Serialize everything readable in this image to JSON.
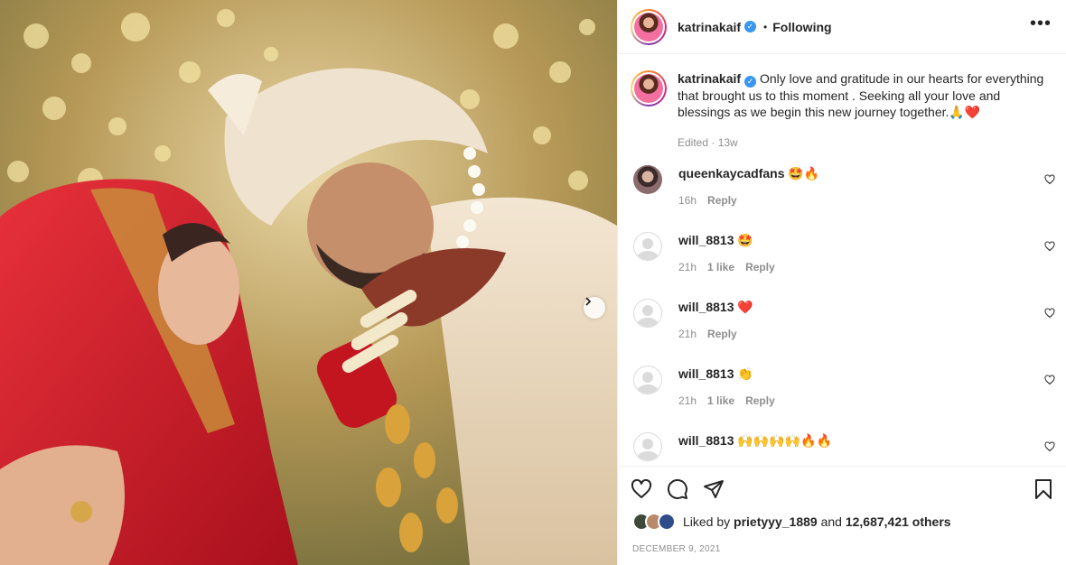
{
  "post": {
    "username": "katrinakaif",
    "follow_status": "Following",
    "separator": "•",
    "more": "•••",
    "media_alt": "Wedding photo of bride and groom embracing"
  },
  "caption": {
    "username": "katrinakaif",
    "text": "Only love and gratitude in our hearts for everything that brought us to this moment . Seeking all your love and blessings as we begin this new journey together.🙏❤️",
    "edited": "Edited · 13w"
  },
  "comments": [
    {
      "username": "queenkaycadfans",
      "text": "🤩🔥",
      "time": "16h",
      "likes": "",
      "reply": "Reply"
    },
    {
      "username": "will_8813",
      "text": "🤩",
      "time": "21h",
      "likes": "1 like",
      "reply": "Reply"
    },
    {
      "username": "will_8813",
      "text": "❤️",
      "time": "21h",
      "likes": "",
      "reply": "Reply"
    },
    {
      "username": "will_8813",
      "text": "👏",
      "time": "21h",
      "likes": "1 like",
      "reply": "Reply"
    },
    {
      "username": "will_8813",
      "text": "🙌🙌🙌🙌🔥🔥",
      "time": "",
      "likes": "",
      "reply": ""
    }
  ],
  "likes": {
    "prefix": "Liked by",
    "user": "prietyyy_1889",
    "and": "and",
    "others": "12,687,421 others"
  },
  "date": "DECEMBER 9, 2021"
}
